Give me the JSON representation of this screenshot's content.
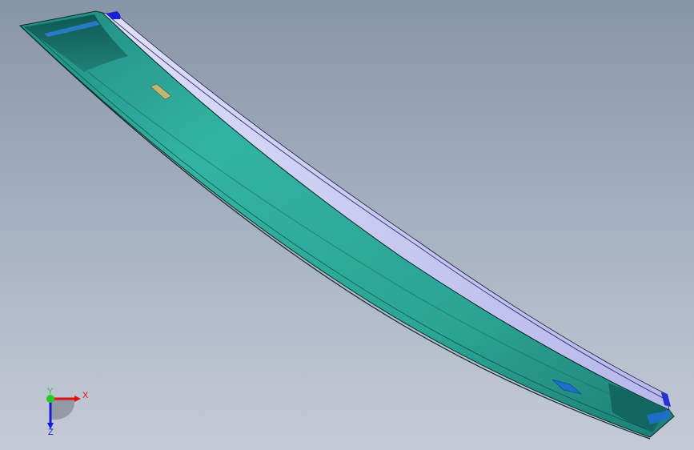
{
  "viewport": {
    "background_top": "#8795a8",
    "background_bottom": "#c4cbd6"
  },
  "model": {
    "body_color": "#2aa594",
    "body_dark": "#0f5f5a",
    "side_color": "#c9cbf2",
    "accent_blue": "#1a22d6"
  },
  "triad": {
    "x_label": "X",
    "y_label": "Y",
    "z_label": "Z",
    "x_color": "#e01010",
    "y_color": "#22cc22",
    "z_color": "#1a1ad8"
  }
}
